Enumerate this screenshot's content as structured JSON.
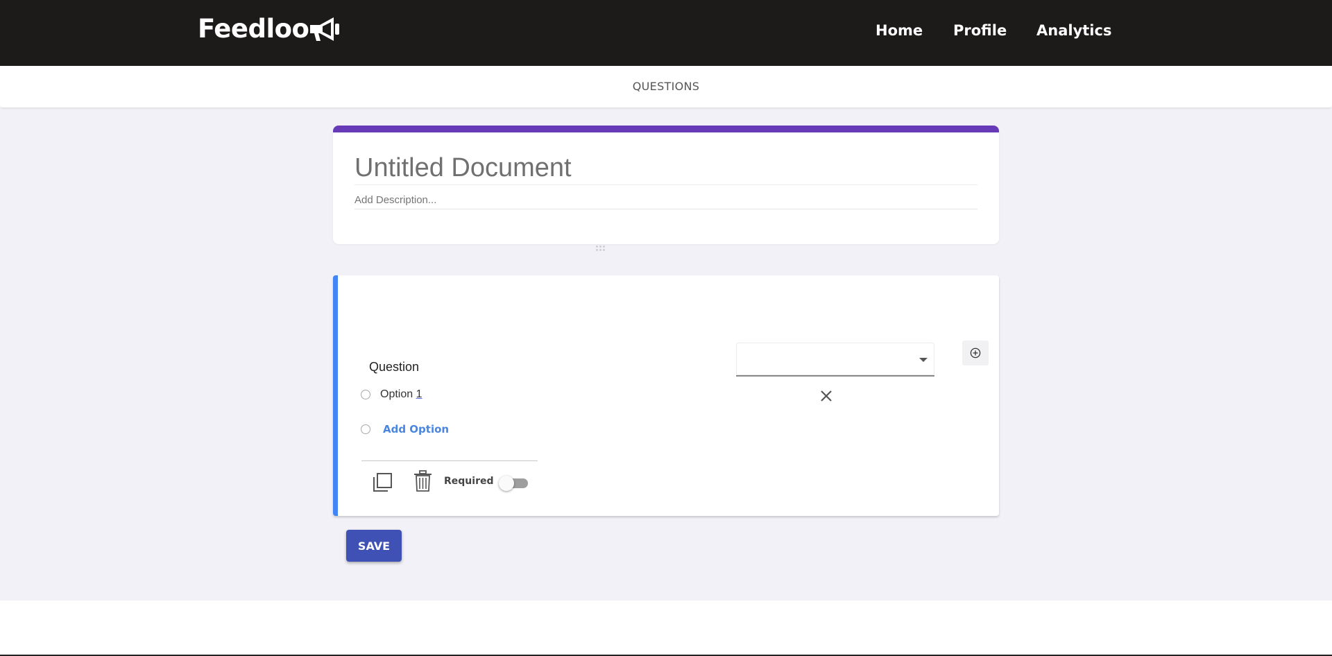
{
  "header": {
    "brand": "Feedloo",
    "brand_icon": "megaphone-icon",
    "nav": [
      {
        "label": "Home"
      },
      {
        "label": "Profile"
      },
      {
        "label": "Analytics"
      }
    ]
  },
  "tabs": {
    "active": "QUESTIONS"
  },
  "form": {
    "title_value": "Untitled Document",
    "description_placeholder": "Add Description..."
  },
  "question": {
    "label": "Question",
    "type_select_value": "",
    "options": [
      {
        "prefix": "Option ",
        "suffix": "1"
      }
    ],
    "add_option_label": "Add Option",
    "required_label": "Required",
    "required": false
  },
  "actions": {
    "save_label": "SAVE"
  },
  "colors": {
    "navbar": "#1d1a1a",
    "title_accent": "#673ab7",
    "question_accent": "#4285f4",
    "save_button": "#3f51b5",
    "background": "#f2f1f7",
    "link_blue": "#4a86e0"
  }
}
